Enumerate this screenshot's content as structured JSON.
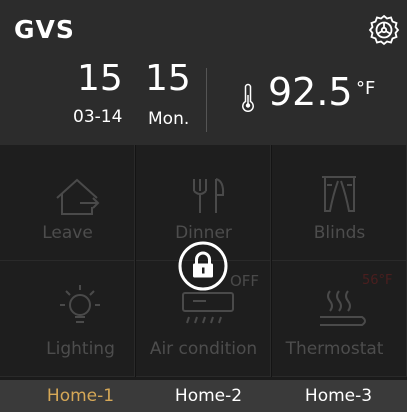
{
  "header": {
    "brand": "GVS",
    "time": {
      "hour": "15",
      "minute": "15"
    },
    "date": "03-14",
    "weekday": "Mon.",
    "temperature": {
      "value": "92.5",
      "unit": "°F"
    }
  },
  "tiles": {
    "leave": "Leave",
    "dinner": "Dinner",
    "blinds": "Blinds",
    "lighting": "Lighting",
    "aircon": "Air condition",
    "thermostat": "Thermostat"
  },
  "dinner_status": "OFF",
  "thermostat_setpoint": "56°F",
  "tabs": [
    "Home-1",
    "Home-2",
    "Home-3"
  ],
  "active_tab": "Home-1",
  "colors": {
    "header_bg": "#2c2c2c",
    "grid_bg": "#1e1e1e",
    "tab_bar_bg": "#3a3a3a",
    "active_tab": "#d6a857",
    "dim_text": "#4d4d4d"
  },
  "icons": {
    "settings": "gear-icon",
    "temperature": "thermometer-icon",
    "leave": "house-exit-icon",
    "dinner": "fork-knife-icon",
    "blinds": "blinds-icon",
    "lighting": "bulb-icon",
    "aircon": "air-conditioner-icon",
    "thermostat": "heating-icon",
    "lock": "padlock-icon"
  }
}
